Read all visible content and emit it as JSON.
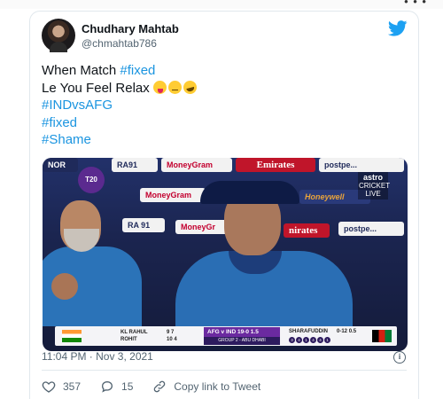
{
  "tweet": {
    "display_name": "Chudhary Mahtab",
    "handle": "@chmahtab786",
    "lines": [
      {
        "plain": "When Match ",
        "hashtag": "#fixed"
      },
      {
        "plain": "Le You Feel Relax "
      },
      {
        "hashtag": "#INDvsAFG"
      },
      {
        "hashtag": "#fixed"
      },
      {
        "hashtag": "#Shame"
      }
    ],
    "emojis": [
      "zany-face-emoji",
      "face-with-raised-eyebrow-emoji",
      "rolling-on-floor-laughing-emoji"
    ],
    "timestamp": "11:04 PM · Nov 3, 2021",
    "likes": "357",
    "replies": "15",
    "copy_link_label": "Copy link to Tweet"
  },
  "media": {
    "boards": {
      "nor": "NOR",
      "ra91_top": "RA91",
      "moneygram_top": "MoneyGram",
      "emirates": "Emirates",
      "postpe_top": "postpe...",
      "moneygram_mid": "MoneyGram",
      "honeywell": "Honeywell",
      "ra91_mid": "RA 91",
      "moneygram_low": "MoneyGr",
      "nirates": "nirates",
      "postpe_mid": "postpe..."
    },
    "t20_logo": "T20",
    "astro": {
      "brand": "astro",
      "channel": "CRICKET",
      "status": "LIVE"
    },
    "scorebar": {
      "batter1": "KL RAHUL",
      "batter1_runs": "9",
      "batter1_balls": "7",
      "batter2": "ROHIT",
      "batter2_runs": "10",
      "batter2_balls": "4",
      "match": "AFG v IND",
      "score": "19-0",
      "overs": "1.5",
      "group": "GROUP 2 - ABU DHABI",
      "bowler": "SHARAFUDDIN",
      "bowler_fig": "0-12",
      "bowler_overs": "0.5",
      "balls": [
        "3",
        "4",
        "1",
        "4",
        "4",
        "1"
      ]
    }
  },
  "colors": {
    "hashtag": "#1b95e0",
    "twitter_blue": "#1da1f2",
    "like_red": "#e0245e"
  }
}
